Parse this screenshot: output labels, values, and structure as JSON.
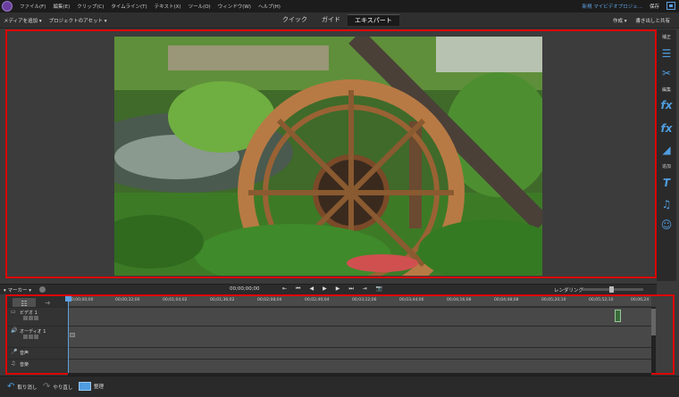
{
  "titlebar": {
    "menu": [
      "ファイル(F)",
      "編集(E)",
      "クリップ(C)",
      "タイムライン(T)",
      "テキスト(X)",
      "ツール(O)",
      "ウィンドウ(W)",
      "ヘルプ(H)"
    ],
    "project_name": "新規 マイビデオプロジェ...",
    "save_label": "保存"
  },
  "toolbar": {
    "add_media": "メディアを追加 ▾",
    "project_assets": "プロジェクトのアセット ▾",
    "tabs": [
      "クイック",
      "ガイド",
      "エキスパート"
    ],
    "active_tab": 2,
    "create": "作成 ▾",
    "export_share": "書き出しと共有"
  },
  "side_panel": {
    "adjust": "補正",
    "edit": "編集",
    "add": "追加"
  },
  "transport": {
    "marker": "▾ マーカー ▾",
    "timecode": "00;00;00;00",
    "buttons": [
      "⇤",
      "⏮",
      "◀",
      "▶",
      "▶",
      "⏭",
      "⇥",
      "📷"
    ],
    "render": "レンダリング"
  },
  "timeline": {
    "ruler_labels": [
      "00;00;00;00",
      "00;00;32;00",
      "00;01;04;02",
      "00;01;36;02",
      "00;02;08;04",
      "00;02;40;04",
      "00;03;12;06",
      "00;03;44;06",
      "00;04;16;08",
      "00;04;48;08",
      "00;05;20;10",
      "00;05;52;10",
      "00;06;24"
    ],
    "tracks": [
      {
        "name": "ビデオ 1",
        "icon": "▭"
      },
      {
        "name": "オーディオ 1",
        "icon": "🔊"
      },
      {
        "name": "音声",
        "icon": "🎤"
      },
      {
        "name": "音楽",
        "icon": "♫"
      }
    ]
  },
  "bottombar": {
    "undo": "取り消し",
    "redo": "やり直し",
    "organizer": "整理"
  },
  "colors": {
    "accent": "#4f9de0",
    "highlight_border": "#dd0000"
  }
}
